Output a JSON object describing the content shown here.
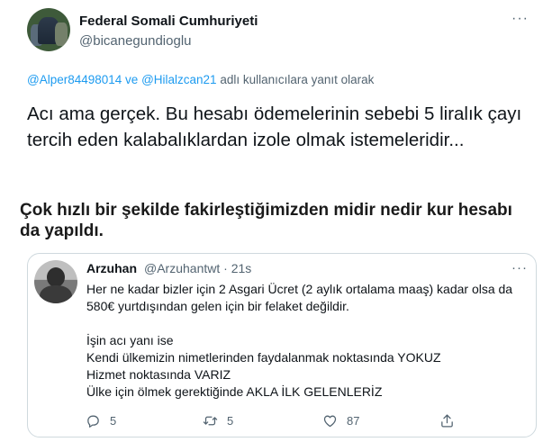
{
  "tweet": {
    "display_name": "Federal Somali Cumhuriyeti",
    "handle": "@bicanegundioglu",
    "more_icon": "ellipsis-icon",
    "reply_context": {
      "mention1": "@Alper84498014",
      "connector": " ve ",
      "mention2": "@Hilalzcan21",
      "suffix": " adlı kullanıcılara yanıt olarak"
    },
    "text": "Acı ama gerçek. Bu hesabı ödemelerinin sebebi 5 liralık çayı tercih eden kalabalıklardan izole olmak istemeleridir..."
  },
  "headline": "Çok hızlı bir şekilde fakirleştiğimizden midir nedir kur hesabı da yapıldı.",
  "quoted": {
    "display_name": "Arzuhan",
    "handle": "@Arzuhantwt",
    "separator": " · ",
    "time": "21s",
    "lines": [
      "Her ne kadar bizler için 2 Asgari Ücret (2 aylık ortalama maaş) kadar olsa da",
      "580€ yurtdışından gelen için bir felaket değildir.",
      "",
      "İşin acı yanı ise",
      "Kendi ülkemizin nimetlerinden faydalanmak noktasında YOKUZ",
      "Hizmet noktasında VARIZ",
      "Ülke için ölmek gerektiğinde AKLA İLK GELENLERİZ"
    ],
    "actions": {
      "reply_count": "5",
      "retweet_count": "5",
      "like_count": "87"
    }
  }
}
